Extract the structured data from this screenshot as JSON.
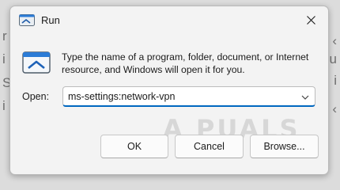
{
  "background": {
    "left_letters": [
      "r",
      "i",
      "S",
      "i"
    ],
    "right_letters": [
      "‹",
      "u",
      "i",
      "‹"
    ]
  },
  "window": {
    "title": "Run",
    "close_icon": "close-icon",
    "app_icon": "run-icon"
  },
  "dialog": {
    "prompt": "Type the name of a program, folder, document, or Internet resource, and Windows will open it for you.",
    "open_label": "Open:",
    "open_value": "ms-settings:network-vpn",
    "dropdown_icon": "chevron-down-icon"
  },
  "buttons": {
    "ok": "OK",
    "cancel": "Cancel",
    "browse": "Browse..."
  },
  "watermark": {
    "text": "A PUALS"
  },
  "colors": {
    "accent": "#0067c0",
    "window_bg": "#f3f3f3",
    "page_bg": "#dcdcdc"
  }
}
